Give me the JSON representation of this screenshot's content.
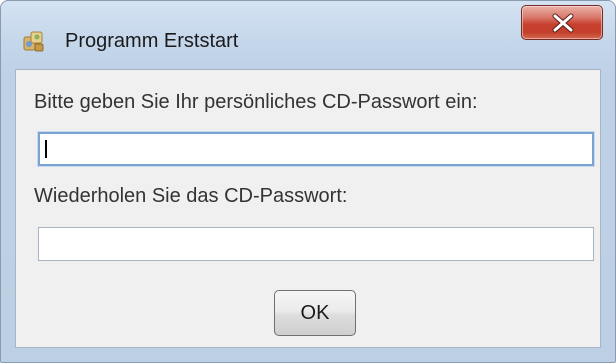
{
  "window": {
    "title": "Programm Erststart",
    "icon": "app-puzzle-icon",
    "close_icon": "close-x-icon"
  },
  "form": {
    "password_label": "Bitte geben Sie Ihr persönliches CD-Passwort ein:",
    "password_value": "",
    "repeat_label": "Wiederholen Sie das CD-Passwort:",
    "repeat_value": "",
    "ok_label": "OK"
  },
  "colors": {
    "close_button": "#c8412f",
    "title_bar": "#c4d6ea",
    "content_background": "#f0f0f0",
    "focus_border": "#7aa3d4"
  }
}
